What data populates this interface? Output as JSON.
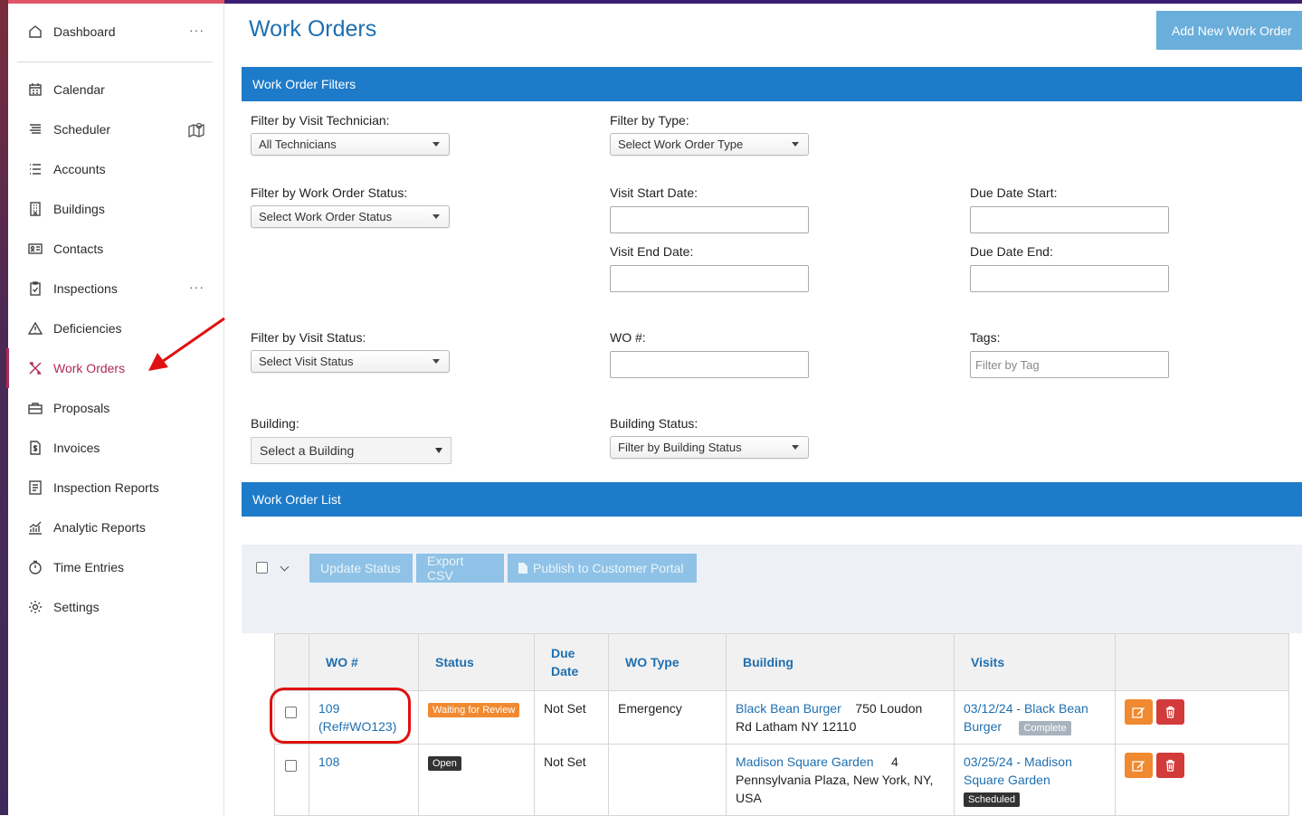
{
  "sidebar": {
    "items": [
      {
        "label": "Dashboard",
        "icon": "home-icon",
        "more": "···"
      },
      {
        "label": "Calendar",
        "icon": "calendar-icon"
      },
      {
        "label": "Scheduler",
        "icon": "scheduler-icon"
      },
      {
        "label": "Accounts",
        "icon": "list-icon"
      },
      {
        "label": "Buildings",
        "icon": "building-icon"
      },
      {
        "label": "Contacts",
        "icon": "contact-card-icon"
      },
      {
        "label": "Inspections",
        "icon": "clipboard-icon",
        "more": "···"
      },
      {
        "label": "Deficiencies",
        "icon": "warning-icon"
      },
      {
        "label": "Work Orders",
        "icon": "tools-icon",
        "active": true
      },
      {
        "label": "Proposals",
        "icon": "briefcase-icon"
      },
      {
        "label": "Invoices",
        "icon": "invoice-icon"
      },
      {
        "label": "Inspection Reports",
        "icon": "report-icon"
      },
      {
        "label": "Analytic Reports",
        "icon": "analytics-icon"
      },
      {
        "label": "Time Entries",
        "icon": "timer-icon"
      },
      {
        "label": "Settings",
        "icon": "gear-icon"
      }
    ]
  },
  "header": {
    "title": "Work Orders",
    "add_button": "Add New Work Order"
  },
  "filters": {
    "section_title": "Work Order Filters",
    "technician": {
      "label": "Filter by Visit Technician:",
      "value": "All Technicians"
    },
    "type": {
      "label": "Filter by Type:",
      "value": "Select Work Order Type"
    },
    "wo_status": {
      "label": "Filter by Work Order Status:",
      "value": "Select Work Order Status"
    },
    "visit_start": {
      "label": "Visit Start Date:"
    },
    "visit_end": {
      "label": "Visit End Date:"
    },
    "due_start": {
      "label": "Due Date Start:"
    },
    "due_end": {
      "label": "Due Date End:"
    },
    "visit_status": {
      "label": "Filter by Visit Status:",
      "value": "Select Visit Status"
    },
    "wo_number": {
      "label": "WO #:"
    },
    "tags": {
      "label": "Tags:",
      "placeholder": "Filter by Tag"
    },
    "building": {
      "label": "Building:",
      "value": "Select a Building"
    },
    "building_status": {
      "label": "Building Status:",
      "value": "Filter by Building Status"
    }
  },
  "list": {
    "section_title": "Work Order List",
    "toolbar": {
      "update_status": "Update Status",
      "export_csv": "Export CSV",
      "publish": "Publish to Customer Portal"
    },
    "columns": [
      "WO #",
      "Status",
      "Due Date",
      "WO Type",
      "Building",
      "Visits"
    ],
    "rows": [
      {
        "wo": "109",
        "wo_ref": "(Ref#WO123)",
        "status": "Waiting for Review",
        "due": "Not Set",
        "type": "Emergency",
        "building_name": "Black Bean Burger",
        "building_addr_1": "750 Loudon",
        "building_addr_2": "Rd Latham NY 12110",
        "visit_link_1": "03/12/24 - Black Bean",
        "visit_link_2": "Burger",
        "visit_status": "Complete"
      },
      {
        "wo": "108",
        "status": "Open",
        "due": "Not Set",
        "type": "",
        "building_name": "Madison Square Garden",
        "building_addr_1": "4",
        "building_addr_2": "Pennsylvania Plaza, New York, NY,",
        "building_addr_3": "USA",
        "visit_link_1": "03/25/24 - Madison",
        "visit_link_2": "Square Garden",
        "visit_status": "Scheduled"
      }
    ]
  },
  "colors": {
    "accent": "#1e7bc9",
    "active_nav": "#b02a55",
    "annotation": "#e01010"
  }
}
